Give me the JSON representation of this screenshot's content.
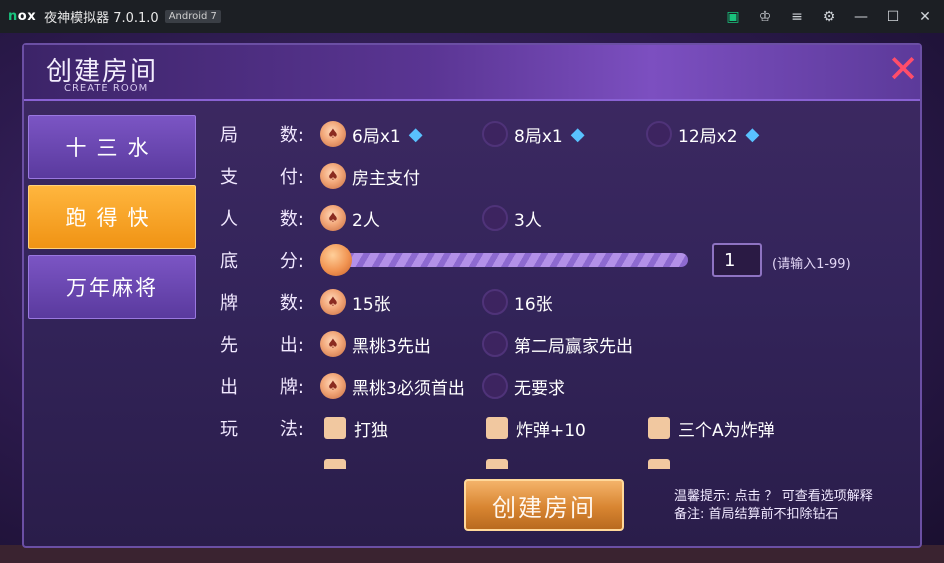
{
  "window": {
    "logo": "nox",
    "title": "夜神模拟器 7.0.1.0",
    "badge": "Android 7",
    "icons": [
      "store-icon",
      "theme-icon",
      "menu-icon",
      "settings-icon",
      "minimize-icon",
      "maximize-icon",
      "close-icon"
    ]
  },
  "dialog": {
    "title": "创建房间",
    "subtitle": "CREATE ROOM"
  },
  "sidebar": {
    "items": [
      {
        "label": "十三水",
        "active": false
      },
      {
        "label": "跑得快",
        "active": true
      },
      {
        "label": "万年麻将",
        "active": false
      }
    ]
  },
  "options": {
    "rounds": {
      "label": "局  数:",
      "choices": [
        {
          "text": "6局x1",
          "selected": true
        },
        {
          "text": "8局x1",
          "selected": false
        },
        {
          "text": "12局x2",
          "selected": false
        }
      ]
    },
    "pay": {
      "label": "支  付:",
      "choices": [
        {
          "text": "房主支付",
          "selected": true
        }
      ]
    },
    "players": {
      "label": "人  数:",
      "choices": [
        {
          "text": "2人",
          "selected": true
        },
        {
          "text": "3人",
          "selected": false
        }
      ]
    },
    "base_score": {
      "label": "底  分:",
      "value": "1",
      "hint": "(请输入1-99)"
    },
    "cards": {
      "label": "牌  数:",
      "choices": [
        {
          "text": "15张",
          "selected": true
        },
        {
          "text": "16张",
          "selected": false
        }
      ]
    },
    "first": {
      "label": "先  出:",
      "choices": [
        {
          "text": "黑桃3先出",
          "selected": true
        },
        {
          "text": "第二局赢家先出",
          "selected": false
        }
      ]
    },
    "play": {
      "label": "出  牌:",
      "choices": [
        {
          "text": "黑桃3必须首出",
          "selected": true
        },
        {
          "text": "无要求",
          "selected": false
        }
      ]
    },
    "rules": {
      "label": "玩  法:",
      "choices": [
        {
          "text": "打独"
        },
        {
          "text": "炸弹+10"
        },
        {
          "text": "三个A为炸弹"
        }
      ]
    }
  },
  "footer": {
    "create_button": "创建房间",
    "tip1": "温馨提示: 点击 ？ 可查看选项解释",
    "tip2": "备注: 首局结算前不扣除钻石"
  },
  "colors": {
    "accent_orange": "#f09314",
    "panel_purple": "#5a3a9e",
    "close_red": "#ff4d6a"
  }
}
